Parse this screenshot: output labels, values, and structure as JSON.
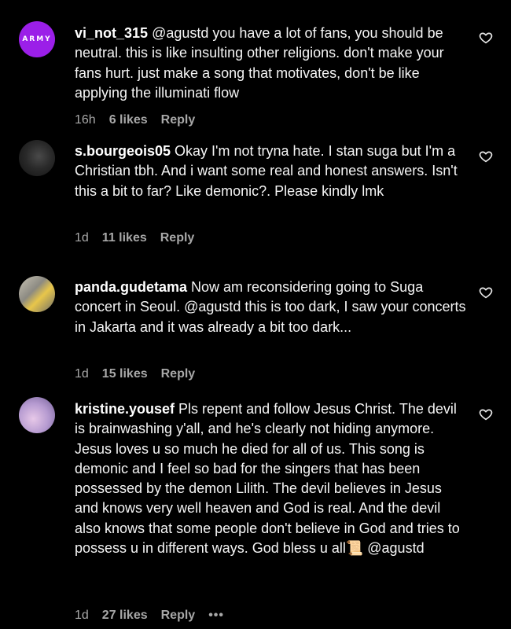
{
  "comments": [
    {
      "avatar": "army-logo-avatar",
      "avatar_text": "ARMY",
      "username": "vi_not_315",
      "text": " @agustd you have a lot of fans, you should be neutral. this is like insulting other religions. don't make your fans hurt. just make a song that motivates, don't be like applying the illuminati flow",
      "time": "16h",
      "likes": "6 likes",
      "reply": "Reply"
    },
    {
      "avatar": "dark-photo-avatar",
      "username": "s.bourgeois05",
      "text": " Okay I'm not tryna hate. I stan suga but I'm a Christian tbh. And i want some real and honest answers. Isn't this a bit to far? Like demonic?. Please kindly lmk",
      "time": "1d",
      "likes": "11 likes",
      "reply": "Reply"
    },
    {
      "avatar": "panda-photo-avatar",
      "username": "panda.gudetama",
      "text": " Now am reconsidering going to Suga concert in Seoul. @agustd this is too dark, I saw your concerts in Jakarta and it was already a bit too dark...",
      "time": "1d",
      "likes": "15 likes",
      "reply": "Reply"
    },
    {
      "avatar": "lilac-photo-avatar",
      "username": "kristine.yousef",
      "text": " Pls repent and follow Jesus Christ. The devil is brainwashing y'all, and he's clearly not hiding anymore. Jesus loves u so much he died for all of us. This song is demonic and I feel so bad for the singers that has been possessed by the demon Lilith. The devil believes in Jesus and knows very well heaven and God is real. And the devil also knows that some people don't believe in God and tries to possess u in different ways. God bless u all📜 @agustd",
      "time": "1d",
      "likes": "27 likes",
      "reply": "Reply",
      "more": "•••"
    }
  ],
  "icons": {
    "like": "heart-outline-icon"
  },
  "colors": {
    "background": "#000000",
    "text": "#f5f5f5",
    "meta": "#a8a8a8",
    "army_badge": "#9b1fe8"
  }
}
